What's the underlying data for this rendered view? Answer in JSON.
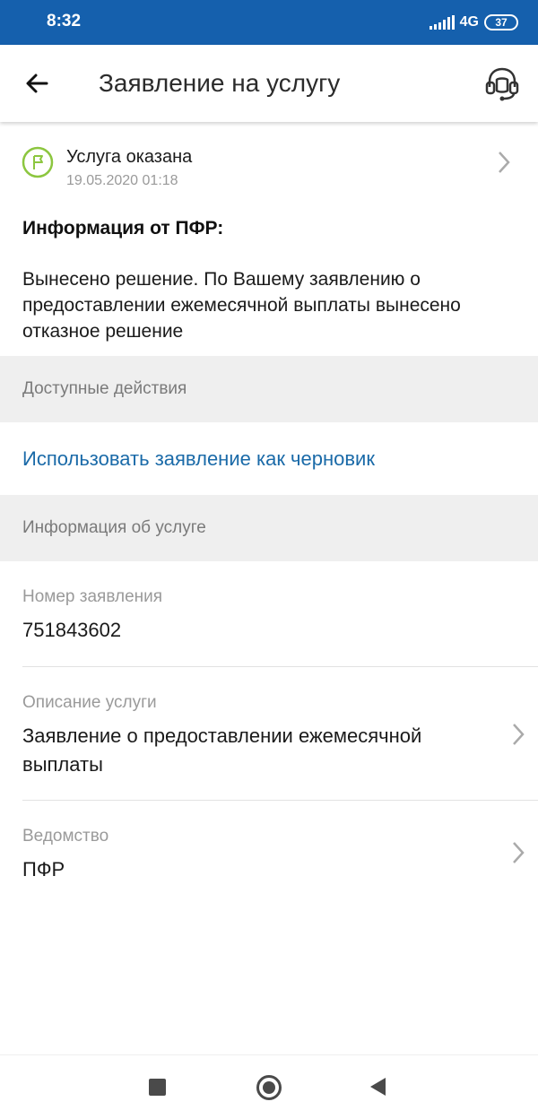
{
  "status_bar": {
    "time": "8:32",
    "network": "4G",
    "battery": "37"
  },
  "header": {
    "title": "Заявление на услугу"
  },
  "status": {
    "title": "Услуга оказана",
    "date": "19.05.2020 01:18"
  },
  "info": {
    "heading": "Информация от ПФР:",
    "text": "Вынесено решение. По Вашему заявлению о предоставлении ежемесячной выплаты вынесено отказное решение"
  },
  "sections": {
    "actions": "Доступные действия",
    "service_info": "Информация об услуге"
  },
  "actions": {
    "use_as_draft": "Использовать заявление как черновик"
  },
  "fields": [
    {
      "label": "Номер заявления",
      "value": "751843602"
    },
    {
      "label": "Описание услуги",
      "value": "Заявление о предоставлении ежемесячной выплаты"
    },
    {
      "label": "Ведомство",
      "value": "ПФР"
    }
  ],
  "colors": {
    "status_bar": "#1560ad",
    "link": "#1a6aa8",
    "success": "#8cc63f",
    "section_bg": "#efefef"
  },
  "icons": [
    "arrow-left-icon",
    "headset-icon",
    "flag-icon",
    "chevron-right-icon",
    "recents-square-icon",
    "home-circle-icon",
    "back-triangle-icon"
  ]
}
